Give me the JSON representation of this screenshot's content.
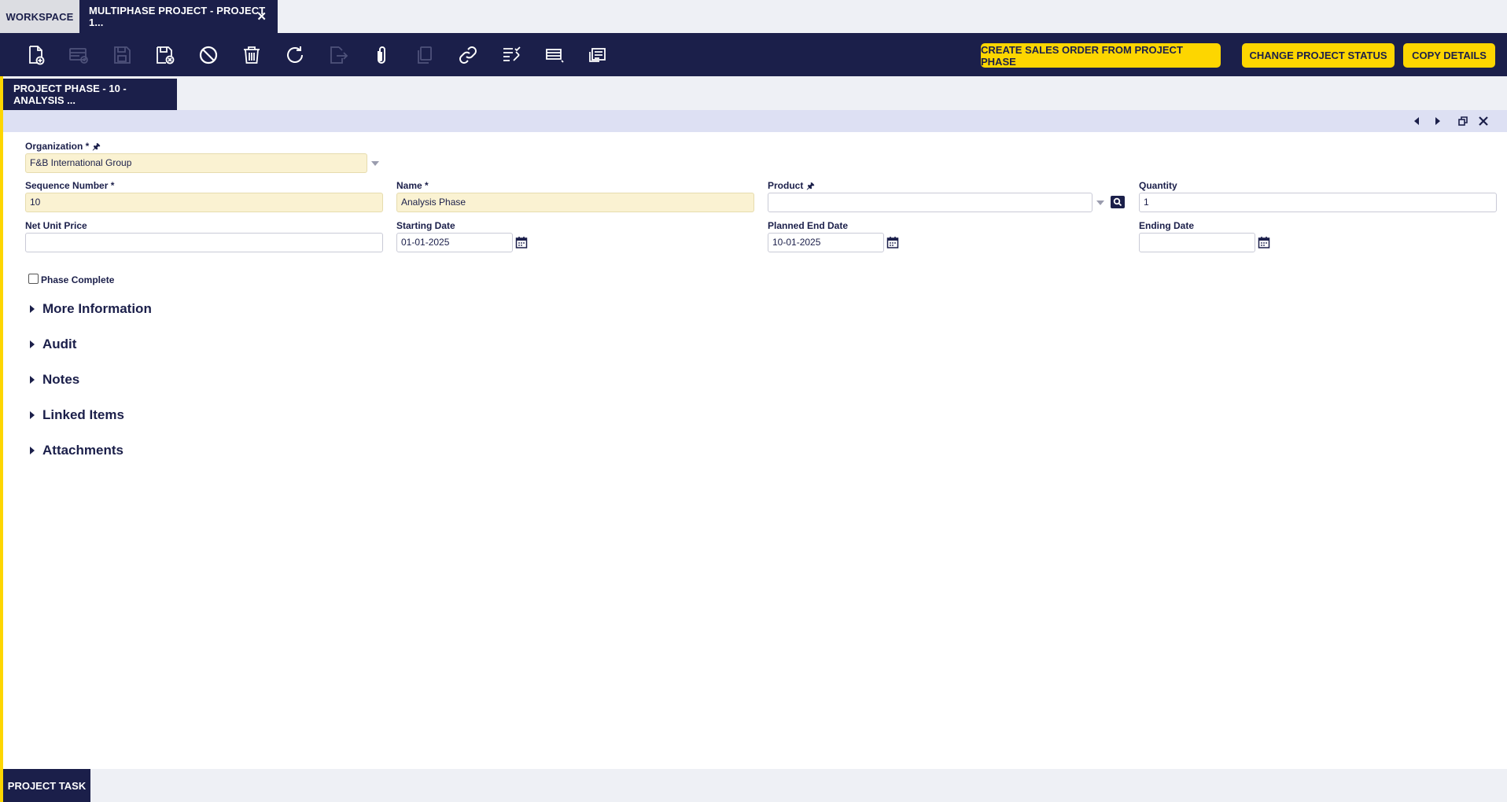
{
  "tabs": {
    "workspace": "Workspace",
    "active": "Multiphase Project - Project 1...",
    "close_glyph": "✕"
  },
  "toolbar": {
    "icons": [
      "new-document-icon",
      "new-record-icon",
      "save-icon",
      "save-close-icon",
      "undo-icon",
      "delete-icon",
      "refresh-icon",
      "export-icon",
      "attach-icon",
      "copy-icon",
      "link-icon",
      "audit-icon",
      "grid-view-icon",
      "notes-icon"
    ],
    "buttons": {
      "create_sales_order": "Create Sales Order from Project Phase",
      "change_status": "Change Project Status",
      "copy_details": "Copy Details"
    }
  },
  "subtab": {
    "label": "Project Phase - 10 - Analysis ..."
  },
  "form": {
    "organization": {
      "label": "Organization *",
      "value": "F&B International Group"
    },
    "sequence_number": {
      "label": "Sequence Number *",
      "value": "10"
    },
    "name": {
      "label": "Name *",
      "value": "Analysis Phase"
    },
    "product": {
      "label": "Product",
      "value": ""
    },
    "quantity": {
      "label": "Quantity",
      "value": "1"
    },
    "net_unit_price": {
      "label": "Net Unit Price",
      "value": ""
    },
    "starting_date": {
      "label": "Starting Date",
      "value": "01-01-2025"
    },
    "planned_end_date": {
      "label": "Planned End Date",
      "value": "10-01-2025"
    },
    "ending_date": {
      "label": "Ending Date",
      "value": ""
    },
    "phase_complete": {
      "label": "Phase Complete",
      "checked": false
    }
  },
  "sections": [
    "More Information",
    "Audit",
    "Notes",
    "Linked Items",
    "Attachments"
  ],
  "bottom_tab": {
    "label": "Project Task"
  },
  "colors": {
    "navy": "#1b1f4a",
    "accent_yellow": "#fdd600",
    "required_bg": "#faf2d2"
  }
}
